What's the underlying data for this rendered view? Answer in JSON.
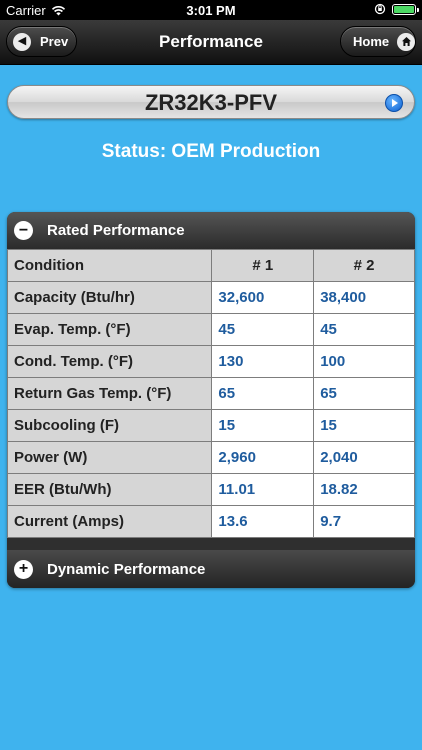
{
  "status_bar": {
    "carrier": "Carrier",
    "time": "3:01 PM"
  },
  "nav": {
    "title": "Performance",
    "prev_label": "Prev",
    "home_label": "Home"
  },
  "model": {
    "name": "ZR32K3-PFV"
  },
  "status_text": "Status: OEM Production",
  "rated_section": {
    "title": "Rated Performance",
    "headers": [
      "Condition",
      "# 1",
      "# 2"
    ],
    "rows": [
      {
        "condition": "Capacity (Btu/hr)",
        "v1": "32,600",
        "v2": "38,400"
      },
      {
        "condition": "Evap. Temp. (°F)",
        "v1": "45",
        "v2": "45"
      },
      {
        "condition": "Cond. Temp. (°F)",
        "v1": "130",
        "v2": "100"
      },
      {
        "condition": "Return Gas Temp. (°F)",
        "v1": "65",
        "v2": "65"
      },
      {
        "condition": "Subcooling (F)",
        "v1": "15",
        "v2": "15"
      },
      {
        "condition": "Power (W)",
        "v1": "2,960",
        "v2": "2,040"
      },
      {
        "condition": "EER (Btu/Wh)",
        "v1": "11.01",
        "v2": "18.82"
      },
      {
        "condition": "Current (Amps)",
        "v1": "13.6",
        "v2": "9.7"
      }
    ]
  },
  "dynamic_section": {
    "title": "Dynamic Performance"
  },
  "colors": {
    "background": "#3fb3ee",
    "value_text": "#1f5c9e",
    "battery": "#4cd964"
  }
}
